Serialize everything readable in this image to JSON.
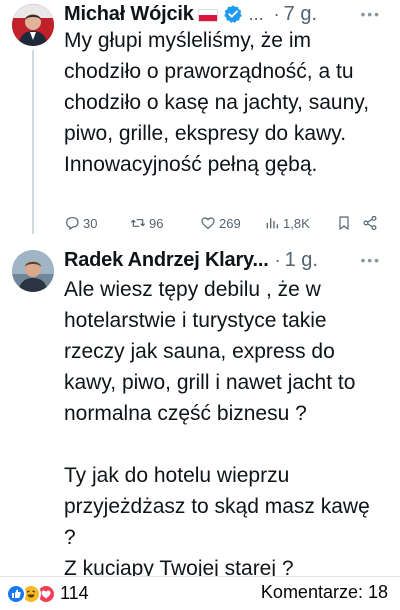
{
  "tweets": [
    {
      "author": "Michał Wójcik",
      "truncation": "...",
      "separator": "·",
      "time": "7 g.",
      "text": "My głupi myśleliśmy, że im chodziło o praworządność, a tu chodziło o kasę na jachty, sauny, piwo, grille, ekspresy do kawy. Innowacyjność pełną gębą.",
      "metrics": {
        "replies": "30",
        "retweets": "96",
        "likes": "269",
        "views": "1,8K"
      }
    },
    {
      "author": "Radek Andrzej Klary...",
      "separator": "·",
      "time": "1 g.",
      "text": "Ale wiesz tępy debilu , że w hotelarstwie i turystyce takie rzeczy jak sauna, express do kawy, piwo, grill i nawet jacht to normalna część biznesu ?\n\nTy jak do hotelu wieprzu przyjeżdżasz to skąd masz kawę ?\nZ kuciapy Twojej starej ?"
    }
  ],
  "footer": {
    "reaction_count": "114",
    "comments_label": "Komentarze: 18"
  },
  "colors": {
    "text": "#0f1419",
    "muted": "#536471",
    "verified": "#1d9bf0",
    "like": "#1877f2",
    "haha": "#f7b928",
    "love": "#f33e58"
  },
  "icons": [
    "reply-icon",
    "retweet-icon",
    "like-icon",
    "views-icon",
    "bookmark-icon",
    "share-icon",
    "verified-icon",
    "more-icon"
  ]
}
